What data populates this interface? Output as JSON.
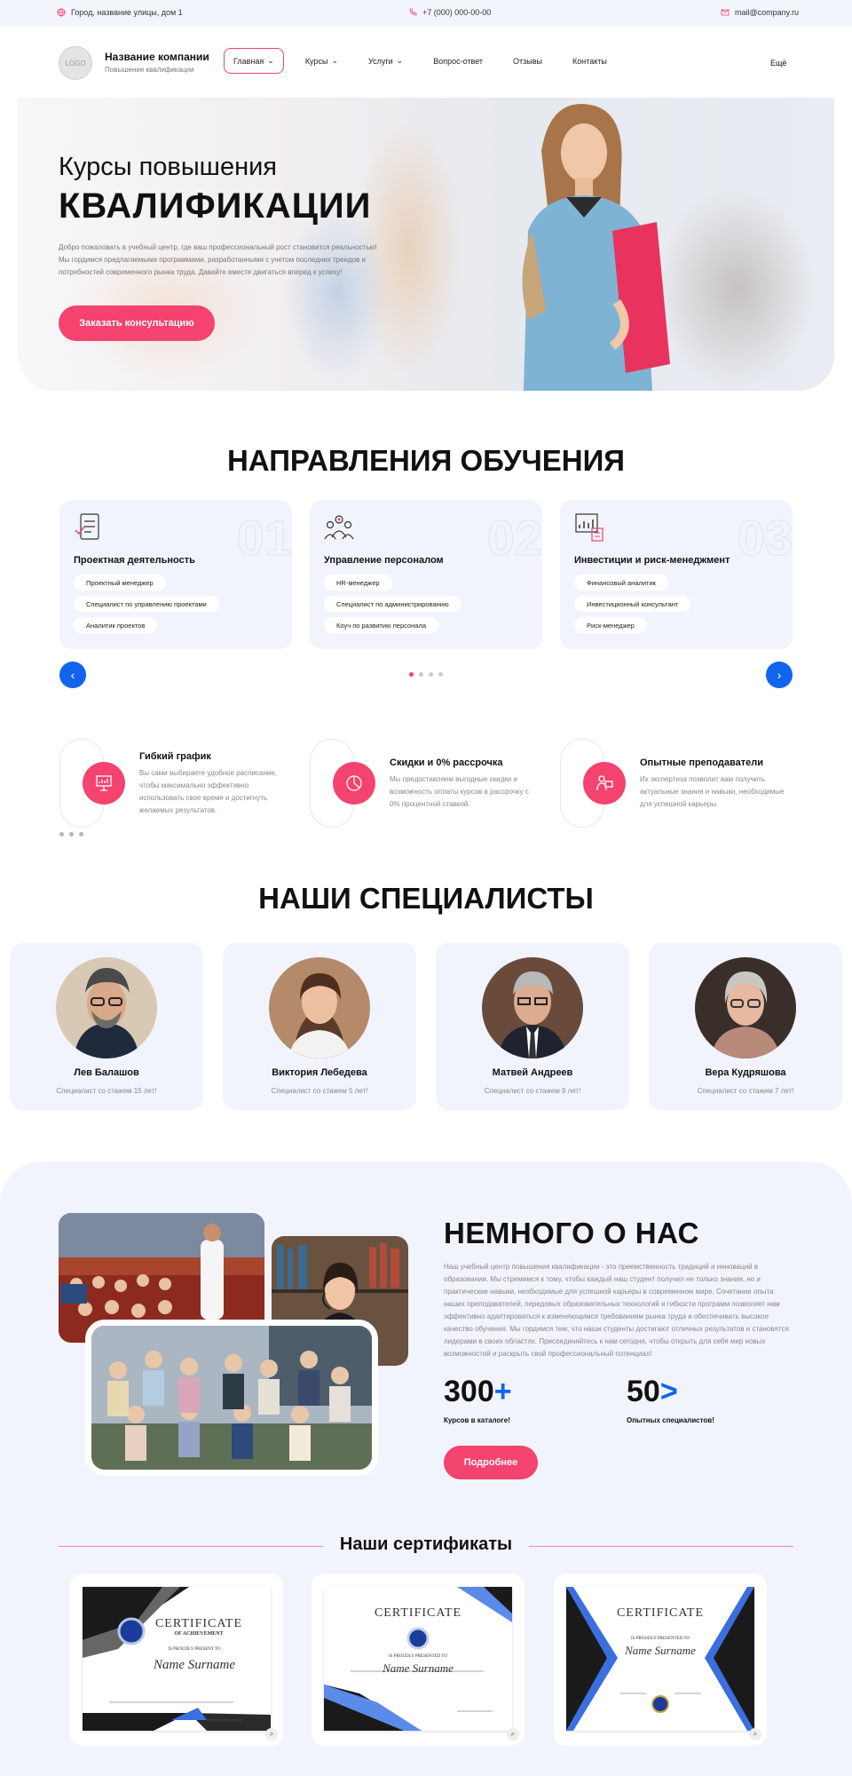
{
  "topbar": {
    "address": "Город, название улицы, дом 1",
    "phone": "+7 (000) 000-00-00",
    "email": "mail@company.ru"
  },
  "header": {
    "logo": "LOGO",
    "company_name": "Название компании",
    "company_sub": "Повышение квалификации",
    "nav": [
      {
        "label": "Главная",
        "dropdown": true,
        "active": true
      },
      {
        "label": "Курсы",
        "dropdown": true
      },
      {
        "label": "Услуги",
        "dropdown": true
      },
      {
        "label": "Вопрос-ответ"
      },
      {
        "label": "Отзывы"
      },
      {
        "label": "Контакты"
      }
    ],
    "more": "Ещё"
  },
  "hero": {
    "title_line1": "Курсы повышения",
    "title_line2": "КВАЛИФИКАЦИИ",
    "text": "Добро пожаловать в учебный центр, где ваш профессиональный рост становится реальностью! Мы гордимся предлагаемыми программами, разработанными с учетом последних трендов и потребностей современного рынка труда. Давайте вместе двигаться вперед к успеху!",
    "button": "Заказать консультацию"
  },
  "directions": {
    "title": "НАПРАВЛЕНИЯ ОБУЧЕНИЯ",
    "cards": [
      {
        "num": "01",
        "title": "Проектная деятельность",
        "icon": "checklist-icon",
        "tags": [
          "Проектный менеджер",
          "Специалист по управлению проектами",
          "Аналитик проектов"
        ]
      },
      {
        "num": "02",
        "title": "Управление персоналом",
        "icon": "team-icon",
        "tags": [
          "HR-менеджер",
          "Специалист по администрированию",
          "Коуч по развитию персонала"
        ]
      },
      {
        "num": "03",
        "title": "Инвестиции и риск-менеджмент",
        "icon": "chart-report-icon",
        "tags": [
          "Финансовый аналитик",
          "Инвестиционный консультант",
          "Риск-менеджер"
        ]
      }
    ],
    "prev": "‹",
    "next": "›"
  },
  "features": [
    {
      "title": "Гибкий график",
      "icon": "presentation-icon",
      "text": "Вы сами выбираете удобное расписание, чтобы максимально эффективно использовать свое время и достигнуть желаемых результатов."
    },
    {
      "title": "Скидки и 0% рассрочка",
      "icon": "discount-icon",
      "text": "Мы предоставляем выгодные скидки и возможность оплаты курсов в рассрочку с 0% процентной ставкой."
    },
    {
      "title": "Опытные преподаватели",
      "icon": "teacher-icon",
      "text": "Их экспертиза позволит вам получить актуальные знания и навыки, необходимые для успешной карьеры."
    }
  ],
  "specialists": {
    "title": "НАШИ СПЕЦИАЛИСТЫ",
    "items": [
      {
        "name": "Лев Балашов",
        "sub": "Специалист со стажем 15 лет!"
      },
      {
        "name": "Виктория Лебедева",
        "sub": "Специалист со стажем 5 лет!"
      },
      {
        "name": "Матвей Андреев",
        "sub": "Специалист со стажем 9 лет!"
      },
      {
        "name": "Вера Кудряшова",
        "sub": "Специалист со стажем 7 лет!"
      }
    ]
  },
  "about": {
    "title": "НЕМНОГО О НАС",
    "text": "Наш учебный центр повышения квалификации - это преемственность традиций и инноваций в образовании. Мы стремимся к тому, чтобы каждый наш студент получил не только знания, но и практические навыки, необходимые для успешной карьеры в современном мире. Сочетание опыта наших преподавателей, передовых образовательных технологий и гибкости программ позволяет нам эффективно адаптироваться к изменяющимся требованиям рынка труда и обеспечивать высокое качество обучения. Мы гордимся тем, что наши студенты достигают отличных результатов и становятся лидерами в своих областях. Присоединяйтесь к нам сегодня, чтобы открыть для себя мир новых возможностей и раскрыть свой профессиональный потенциал!",
    "stats": [
      {
        "value": "300",
        "suffix": "+",
        "label": "Курсов в каталоге!"
      },
      {
        "value": "50",
        "suffix": ">",
        "label": "Опытных специалистов!"
      }
    ],
    "button": "Подробнее"
  },
  "certificates": {
    "title": "Наши сертификаты",
    "items": [
      {
        "heading": "CERTIFICATE",
        "sub": "OF ACHIEVEMENT",
        "present": "IS PROUDLY PRESENT TO",
        "name": "Name Surname"
      },
      {
        "heading": "CERTIFICATE",
        "present": "IS PROUDLY PRESENTED TO",
        "name": "Name Surname"
      },
      {
        "heading": "CERTIFICATE",
        "present": "IS PROUDLY PRESENTED TO",
        "name": "Name Surname"
      }
    ]
  },
  "colors": {
    "accent": "#f3436e",
    "blue": "#1164ec",
    "card_bg": "#f2f4fd"
  }
}
